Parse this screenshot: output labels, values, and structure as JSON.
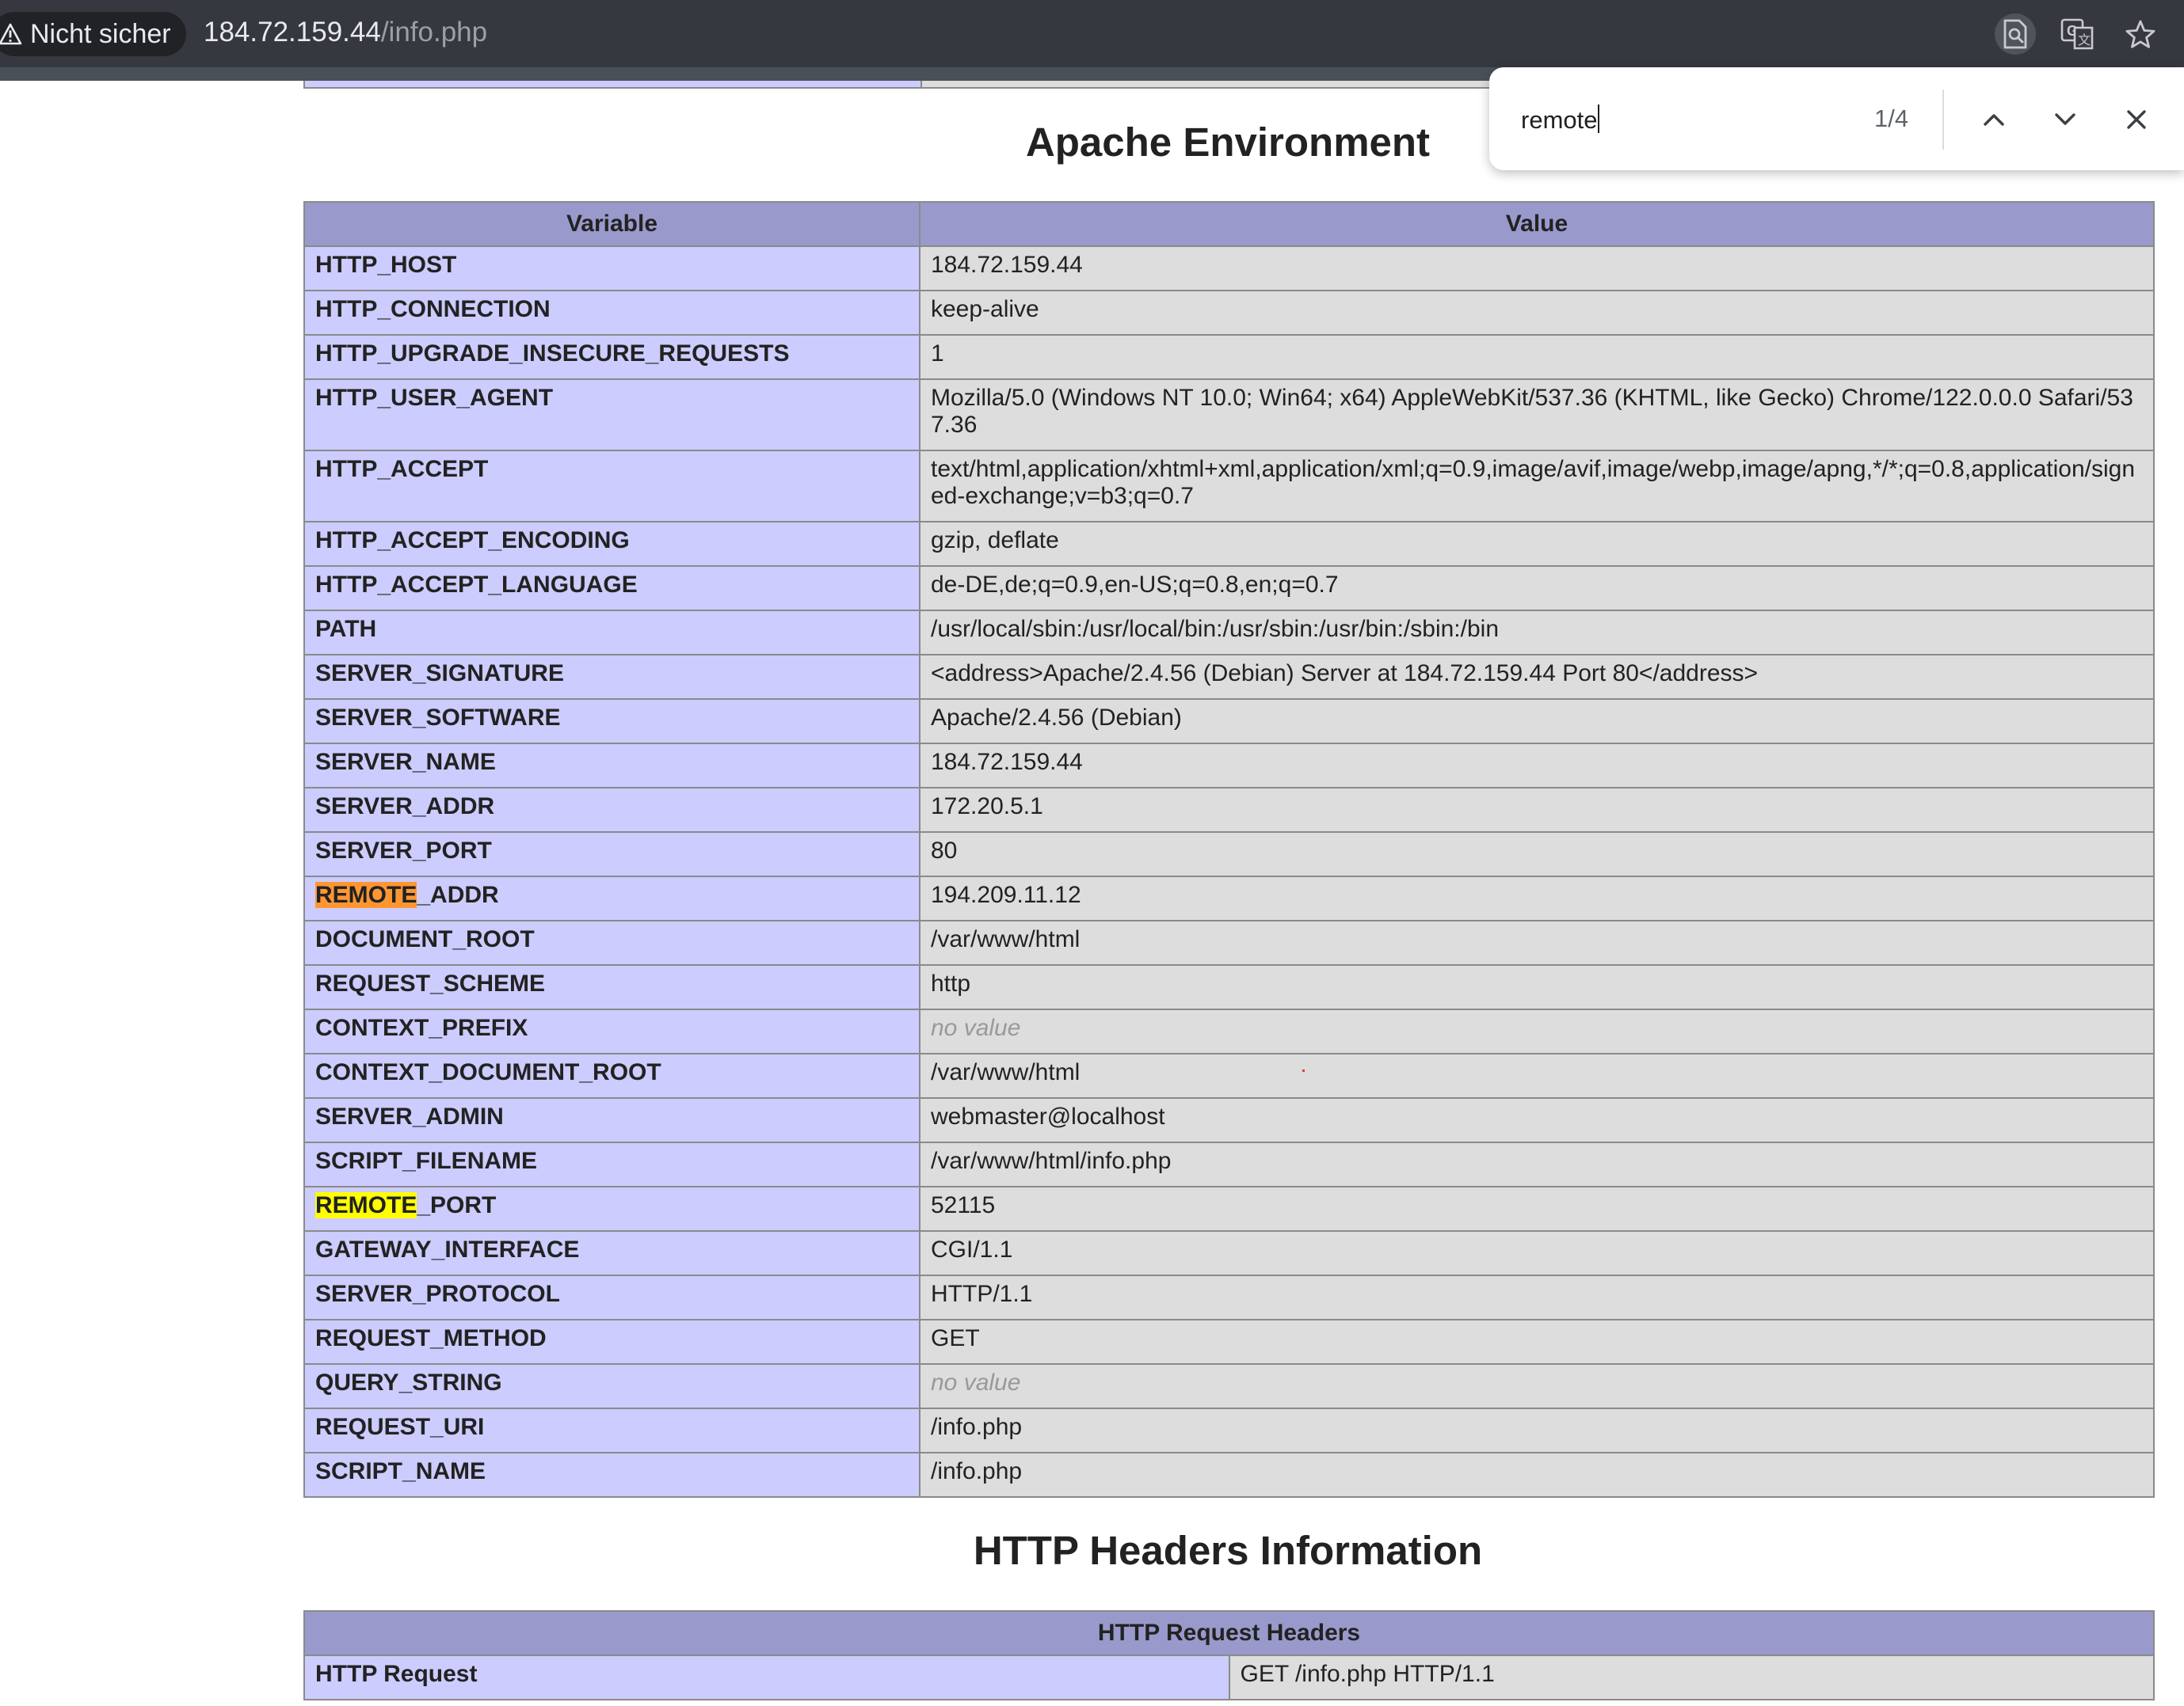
{
  "browser": {
    "security_label": "Nicht sicher",
    "url_host": "184.72.159.44",
    "url_path": "/info.php",
    "icons": [
      "page-search-icon",
      "translate-icon",
      "bookmark-star-icon"
    ]
  },
  "find_bar": {
    "query": "remote",
    "match_count": "1/4"
  },
  "apache_env": {
    "title": "Apache Environment",
    "headers": [
      "Variable",
      "Value"
    ],
    "rows": [
      {
        "name": "HTTP_HOST",
        "value": "184.72.159.44"
      },
      {
        "name": "HTTP_CONNECTION",
        "value": "keep-alive"
      },
      {
        "name": "HTTP_UPGRADE_INSECURE_REQUESTS",
        "value": "1"
      },
      {
        "name": "HTTP_USER_AGENT",
        "value": "Mozilla/5.0 (Windows NT 10.0; Win64; x64) AppleWebKit/537.36 (KHTML, like Gecko) Chrome/122.0.0.0 Safari/537.36"
      },
      {
        "name": "HTTP_ACCEPT",
        "value": "text/html,application/xhtml+xml,application/xml;q=0.9,image/avif,image/webp,image/apng,*/*;q=0.8,application/signed-exchange;v=b3;q=0.7"
      },
      {
        "name": "HTTP_ACCEPT_ENCODING",
        "value": "gzip, deflate"
      },
      {
        "name": "HTTP_ACCEPT_LANGUAGE",
        "value": "de-DE,de;q=0.9,en-US;q=0.8,en;q=0.7"
      },
      {
        "name": "PATH",
        "value": "/usr/local/sbin:/usr/local/bin:/usr/sbin:/usr/bin:/sbin:/bin"
      },
      {
        "name": "SERVER_SIGNATURE",
        "value": "<address>Apache/2.4.56 (Debian) Server at 184.72.159.44 Port 80</address>"
      },
      {
        "name": "SERVER_SOFTWARE",
        "value": "Apache/2.4.56 (Debian)"
      },
      {
        "name": "SERVER_NAME",
        "value": "184.72.159.44"
      },
      {
        "name": "SERVER_ADDR",
        "value": "172.20.5.1"
      },
      {
        "name": "SERVER_PORT",
        "value": "80"
      },
      {
        "name_hl": "REMOTE",
        "name_rest": "_ADDR",
        "highlight": "current",
        "value": "194.209.11.12"
      },
      {
        "name": "DOCUMENT_ROOT",
        "value": "/var/www/html"
      },
      {
        "name": "REQUEST_SCHEME",
        "value": "http"
      },
      {
        "name": "CONTEXT_PREFIX",
        "value": "no value",
        "no_value": true
      },
      {
        "name": "CONTEXT_DOCUMENT_ROOT",
        "value": "/var/www/html"
      },
      {
        "name": "SERVER_ADMIN",
        "value": "webmaster@localhost"
      },
      {
        "name": "SCRIPT_FILENAME",
        "value": "/var/www/html/info.php"
      },
      {
        "name_hl": "REMOTE",
        "name_rest": "_PORT",
        "highlight": "match",
        "value": "52115"
      },
      {
        "name": "GATEWAY_INTERFACE",
        "value": "CGI/1.1"
      },
      {
        "name": "SERVER_PROTOCOL",
        "value": "HTTP/1.1"
      },
      {
        "name": "REQUEST_METHOD",
        "value": "GET"
      },
      {
        "name": "QUERY_STRING",
        "value": "no value",
        "no_value": true
      },
      {
        "name": "REQUEST_URI",
        "value": "/info.php"
      },
      {
        "name": "SCRIPT_NAME",
        "value": "/info.php"
      }
    ]
  },
  "http_headers": {
    "title": "HTTP Headers Information",
    "table_header": "HTTP Request Headers",
    "rows": [
      {
        "name": "HTTP Request",
        "value": "GET /info.php HTTP/1.1"
      }
    ]
  }
}
